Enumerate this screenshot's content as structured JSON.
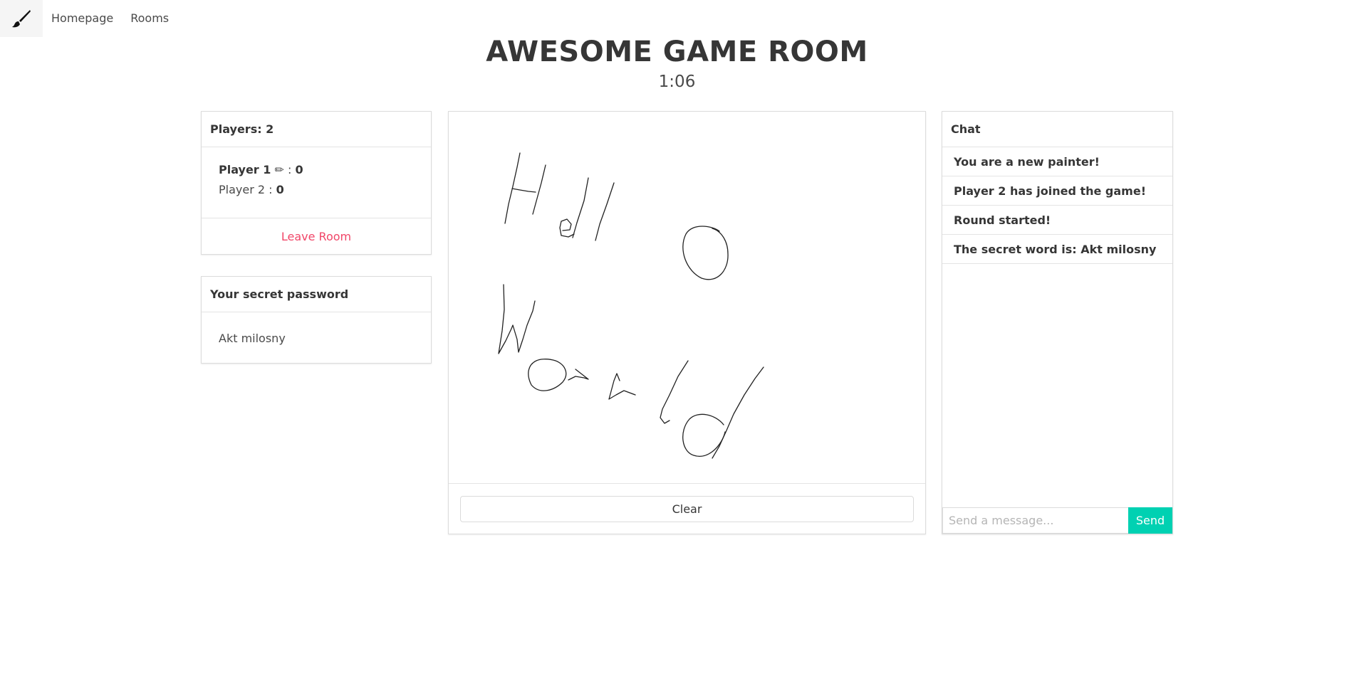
{
  "nav": {
    "brand_icon": "paintbrush-icon",
    "links": [
      "Homepage",
      "Rooms"
    ]
  },
  "header": {
    "title": "AWESOME GAME ROOM",
    "timer": "1:06"
  },
  "players": {
    "header": "Players: 2",
    "list": [
      {
        "name": "Player 1",
        "painter_icon": "✏",
        "separator": " : ",
        "score": "0"
      },
      {
        "name": "Player 2",
        "separator": " : ",
        "score": "0"
      }
    ],
    "leave_label": "Leave Room"
  },
  "secret": {
    "header": "Your secret password",
    "word": "Akt milosny"
  },
  "canvas": {
    "clear_label": "Clear"
  },
  "chat": {
    "header": "Chat",
    "messages": [
      "You are a new painter!",
      "Player 2 has joined the game!",
      "Round started!",
      "The secret word is: Akt milosny"
    ],
    "input_placeholder": "Send a message...",
    "send_label": "Send"
  },
  "colors": {
    "accent": "#00d1b2",
    "danger": "#f14668"
  }
}
